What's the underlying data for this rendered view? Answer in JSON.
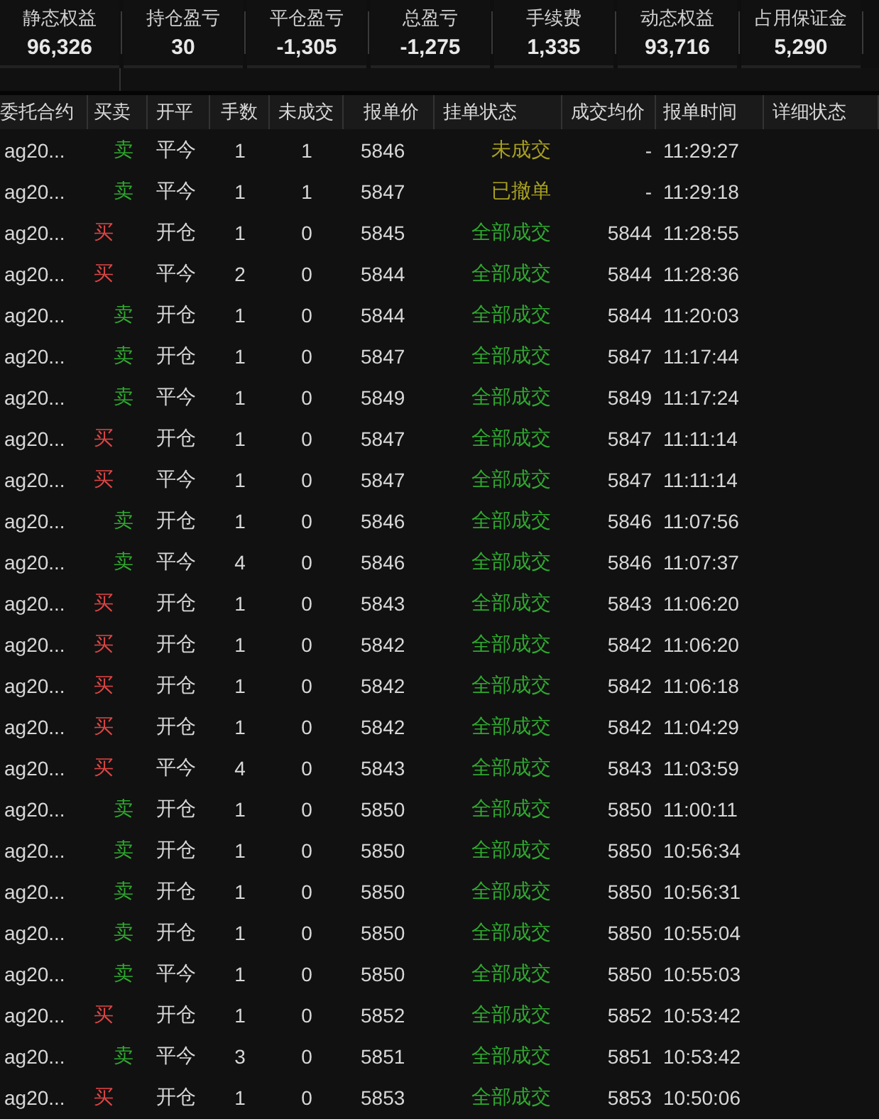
{
  "summary": [
    {
      "label": "静态权益",
      "value": "96,326"
    },
    {
      "label": "持仓盈亏",
      "value": "30"
    },
    {
      "label": "平仓盈亏",
      "value": "-1,305"
    },
    {
      "label": "总盈亏",
      "value": "-1,275"
    },
    {
      "label": "手续费",
      "value": "1,335"
    },
    {
      "label": "动态权益",
      "value": "93,716"
    },
    {
      "label": "占用保证金",
      "value": "5,290"
    }
  ],
  "table": {
    "columns": [
      "委托合约",
      "买卖",
      "开平",
      "手数",
      "未成交",
      "报单价",
      "挂单状态",
      "成交均价",
      "报单时间",
      "详细状态"
    ],
    "rows": [
      {
        "contract": "ag20...",
        "side": {
          "text": "卖",
          "kind": "sell"
        },
        "offset": "平今",
        "qty": "1",
        "unfilled": "1",
        "price": "5846",
        "status": {
          "text": "未成交",
          "kind": "pending"
        },
        "avg": "-",
        "time": "11:29:27"
      },
      {
        "contract": "ag20...",
        "side": {
          "text": "卖",
          "kind": "sell"
        },
        "offset": "平今",
        "qty": "1",
        "unfilled": "1",
        "price": "5847",
        "status": {
          "text": "已撤单",
          "kind": "pending"
        },
        "avg": "-",
        "time": "11:29:18"
      },
      {
        "contract": "ag20...",
        "side": {
          "text": "买",
          "kind": "buy"
        },
        "offset": "开仓",
        "qty": "1",
        "unfilled": "0",
        "price": "5845",
        "status": {
          "text": "全部成交",
          "kind": "filled"
        },
        "avg": "5844",
        "time": "11:28:55"
      },
      {
        "contract": "ag20...",
        "side": {
          "text": "买",
          "kind": "buy"
        },
        "offset": "平今",
        "qty": "2",
        "unfilled": "0",
        "price": "5844",
        "status": {
          "text": "全部成交",
          "kind": "filled"
        },
        "avg": "5844",
        "time": "11:28:36"
      },
      {
        "contract": "ag20...",
        "side": {
          "text": "卖",
          "kind": "sell"
        },
        "offset": "开仓",
        "qty": "1",
        "unfilled": "0",
        "price": "5844",
        "status": {
          "text": "全部成交",
          "kind": "filled"
        },
        "avg": "5844",
        "time": "11:20:03"
      },
      {
        "contract": "ag20...",
        "side": {
          "text": "卖",
          "kind": "sell"
        },
        "offset": "开仓",
        "qty": "1",
        "unfilled": "0",
        "price": "5847",
        "status": {
          "text": "全部成交",
          "kind": "filled"
        },
        "avg": "5847",
        "time": "11:17:44"
      },
      {
        "contract": "ag20...",
        "side": {
          "text": "卖",
          "kind": "sell"
        },
        "offset": "平今",
        "qty": "1",
        "unfilled": "0",
        "price": "5849",
        "status": {
          "text": "全部成交",
          "kind": "filled"
        },
        "avg": "5849",
        "time": "11:17:24"
      },
      {
        "contract": "ag20...",
        "side": {
          "text": "买",
          "kind": "buy"
        },
        "offset": "开仓",
        "qty": "1",
        "unfilled": "0",
        "price": "5847",
        "status": {
          "text": "全部成交",
          "kind": "filled"
        },
        "avg": "5847",
        "time": "11:11:14"
      },
      {
        "contract": "ag20...",
        "side": {
          "text": "买",
          "kind": "buy"
        },
        "offset": "平今",
        "qty": "1",
        "unfilled": "0",
        "price": "5847",
        "status": {
          "text": "全部成交",
          "kind": "filled"
        },
        "avg": "5847",
        "time": "11:11:14"
      },
      {
        "contract": "ag20...",
        "side": {
          "text": "卖",
          "kind": "sell"
        },
        "offset": "开仓",
        "qty": "1",
        "unfilled": "0",
        "price": "5846",
        "status": {
          "text": "全部成交",
          "kind": "filled"
        },
        "avg": "5846",
        "time": "11:07:56"
      },
      {
        "contract": "ag20...",
        "side": {
          "text": "卖",
          "kind": "sell"
        },
        "offset": "平今",
        "qty": "4",
        "unfilled": "0",
        "price": "5846",
        "status": {
          "text": "全部成交",
          "kind": "filled"
        },
        "avg": "5846",
        "time": "11:07:37"
      },
      {
        "contract": "ag20...",
        "side": {
          "text": "买",
          "kind": "buy"
        },
        "offset": "开仓",
        "qty": "1",
        "unfilled": "0",
        "price": "5843",
        "status": {
          "text": "全部成交",
          "kind": "filled"
        },
        "avg": "5843",
        "time": "11:06:20"
      },
      {
        "contract": "ag20...",
        "side": {
          "text": "买",
          "kind": "buy"
        },
        "offset": "开仓",
        "qty": "1",
        "unfilled": "0",
        "price": "5842",
        "status": {
          "text": "全部成交",
          "kind": "filled"
        },
        "avg": "5842",
        "time": "11:06:20"
      },
      {
        "contract": "ag20...",
        "side": {
          "text": "买",
          "kind": "buy"
        },
        "offset": "开仓",
        "qty": "1",
        "unfilled": "0",
        "price": "5842",
        "status": {
          "text": "全部成交",
          "kind": "filled"
        },
        "avg": "5842",
        "time": "11:06:18"
      },
      {
        "contract": "ag20...",
        "side": {
          "text": "买",
          "kind": "buy"
        },
        "offset": "开仓",
        "qty": "1",
        "unfilled": "0",
        "price": "5842",
        "status": {
          "text": "全部成交",
          "kind": "filled"
        },
        "avg": "5842",
        "time": "11:04:29"
      },
      {
        "contract": "ag20...",
        "side": {
          "text": "买",
          "kind": "buy"
        },
        "offset": "平今",
        "qty": "4",
        "unfilled": "0",
        "price": "5843",
        "status": {
          "text": "全部成交",
          "kind": "filled"
        },
        "avg": "5843",
        "time": "11:03:59"
      },
      {
        "contract": "ag20...",
        "side": {
          "text": "卖",
          "kind": "sell"
        },
        "offset": "开仓",
        "qty": "1",
        "unfilled": "0",
        "price": "5850",
        "status": {
          "text": "全部成交",
          "kind": "filled"
        },
        "avg": "5850",
        "time": "11:00:11"
      },
      {
        "contract": "ag20...",
        "side": {
          "text": "卖",
          "kind": "sell"
        },
        "offset": "开仓",
        "qty": "1",
        "unfilled": "0",
        "price": "5850",
        "status": {
          "text": "全部成交",
          "kind": "filled"
        },
        "avg": "5850",
        "time": "10:56:34"
      },
      {
        "contract": "ag20...",
        "side": {
          "text": "卖",
          "kind": "sell"
        },
        "offset": "开仓",
        "qty": "1",
        "unfilled": "0",
        "price": "5850",
        "status": {
          "text": "全部成交",
          "kind": "filled"
        },
        "avg": "5850",
        "time": "10:56:31"
      },
      {
        "contract": "ag20...",
        "side": {
          "text": "卖",
          "kind": "sell"
        },
        "offset": "开仓",
        "qty": "1",
        "unfilled": "0",
        "price": "5850",
        "status": {
          "text": "全部成交",
          "kind": "filled"
        },
        "avg": "5850",
        "time": "10:55:04"
      },
      {
        "contract": "ag20...",
        "side": {
          "text": "卖",
          "kind": "sell"
        },
        "offset": "平今",
        "qty": "1",
        "unfilled": "0",
        "price": "5850",
        "status": {
          "text": "全部成交",
          "kind": "filled"
        },
        "avg": "5850",
        "time": "10:55:03"
      },
      {
        "contract": "ag20...",
        "side": {
          "text": "买",
          "kind": "buy"
        },
        "offset": "开仓",
        "qty": "1",
        "unfilled": "0",
        "price": "5852",
        "status": {
          "text": "全部成交",
          "kind": "filled"
        },
        "avg": "5852",
        "time": "10:53:42"
      },
      {
        "contract": "ag20...",
        "side": {
          "text": "卖",
          "kind": "sell"
        },
        "offset": "平今",
        "qty": "3",
        "unfilled": "0",
        "price": "5851",
        "status": {
          "text": "全部成交",
          "kind": "filled"
        },
        "avg": "5851",
        "time": "10:53:42"
      },
      {
        "contract": "ag20...",
        "side": {
          "text": "买",
          "kind": "buy"
        },
        "offset": "开仓",
        "qty": "1",
        "unfilled": "0",
        "price": "5853",
        "status": {
          "text": "全部成交",
          "kind": "filled"
        },
        "avg": "5853",
        "time": "10:50:06"
      }
    ]
  }
}
